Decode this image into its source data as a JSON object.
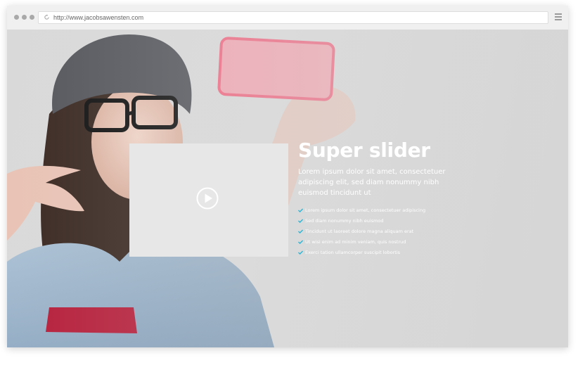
{
  "browser": {
    "url": "http://www.jacobsawensten.com"
  },
  "hero": {
    "title": "Super slider",
    "description": "Lorem ipsum dolor sit amet, consectetuer adipiscing elit, sed diam nonummy nibh euismod tincidunt ut",
    "features": [
      "Lorem ipsum dolor sit amet, consectetuer adipiscing",
      "Sed diam nonummy nibh euismod",
      "Tincidunt ut laoreet dolore magna aliquam erat",
      "Ut wisi enim ad minim veniam, quis nostrud",
      "Exerci tation ullamcorper suscipit lobortis"
    ]
  },
  "colors": {
    "accent_check": "#29b6d6",
    "chrome_bg": "#f0f0f0",
    "hero_bg": "#d9d9d9"
  },
  "icons": {
    "window_controls": "window-dots-icon",
    "refresh": "refresh-icon",
    "menu": "hamburger-menu-icon",
    "play": "play-icon",
    "check": "check-icon"
  }
}
